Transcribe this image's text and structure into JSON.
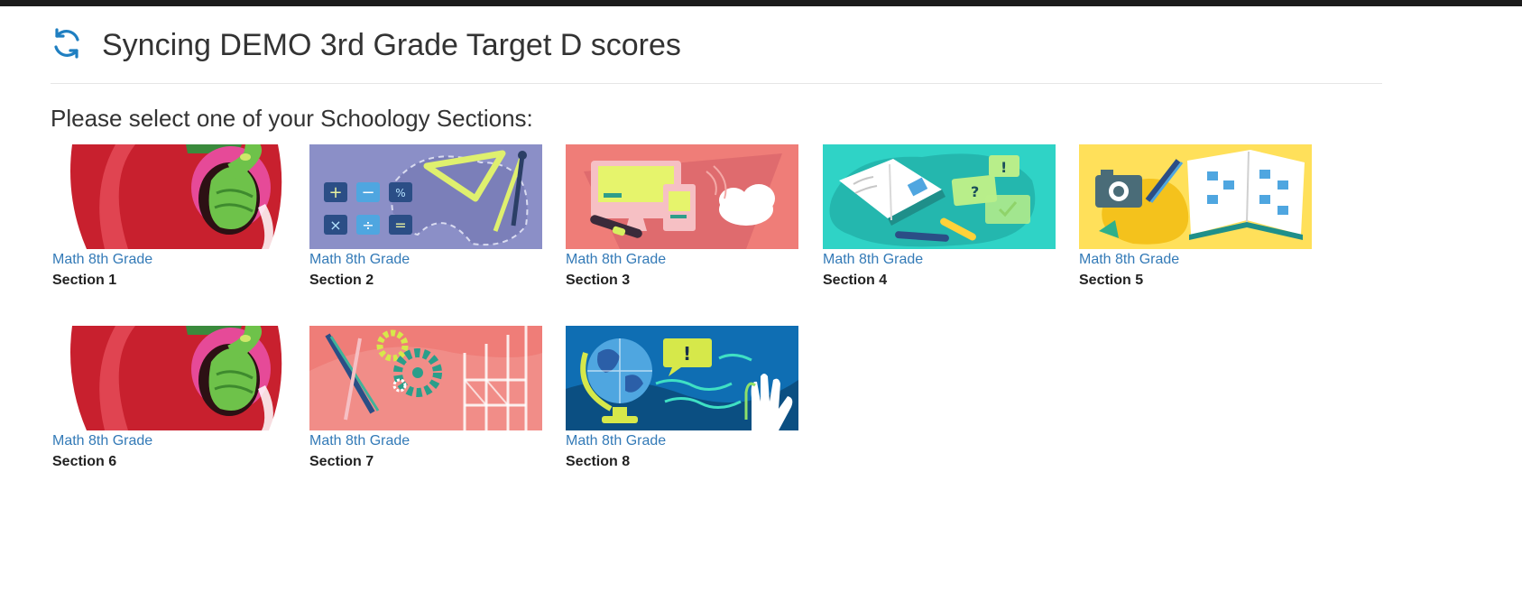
{
  "header": {
    "title": "Syncing DEMO 3rd Grade Target D scores",
    "icon": "sync-icon",
    "accent_color": "#1f7fc1"
  },
  "prompt": "Please select one of your Schoology Sections:",
  "sections": [
    {
      "course": "Math 8th Grade",
      "section": "Section 1",
      "art": "apple-worm"
    },
    {
      "course": "Math 8th Grade",
      "section": "Section 2",
      "art": "math-tools"
    },
    {
      "course": "Math 8th Grade",
      "section": "Section 3",
      "art": "computer-cloud"
    },
    {
      "course": "Math 8th Grade",
      "section": "Section 4",
      "art": "open-book-chat"
    },
    {
      "course": "Math 8th Grade",
      "section": "Section 5",
      "art": "camera-book"
    },
    {
      "course": "Math 8th Grade",
      "section": "Section 6",
      "art": "apple-worm"
    },
    {
      "course": "Math 8th Grade",
      "section": "Section 7",
      "art": "gears-tower"
    },
    {
      "course": "Math 8th Grade",
      "section": "Section 8",
      "art": "globe-hand"
    }
  ],
  "colors": {
    "link": "#337ab7",
    "apple": "#c8202e",
    "math_tools": "#8b8fc7",
    "computer_cloud": "#ef7d78",
    "open_book": "#2fd3c6",
    "camera_book": "#ffe05a",
    "gears_tower": "#ef7d78",
    "globe_hand": "#0f6eb3"
  }
}
